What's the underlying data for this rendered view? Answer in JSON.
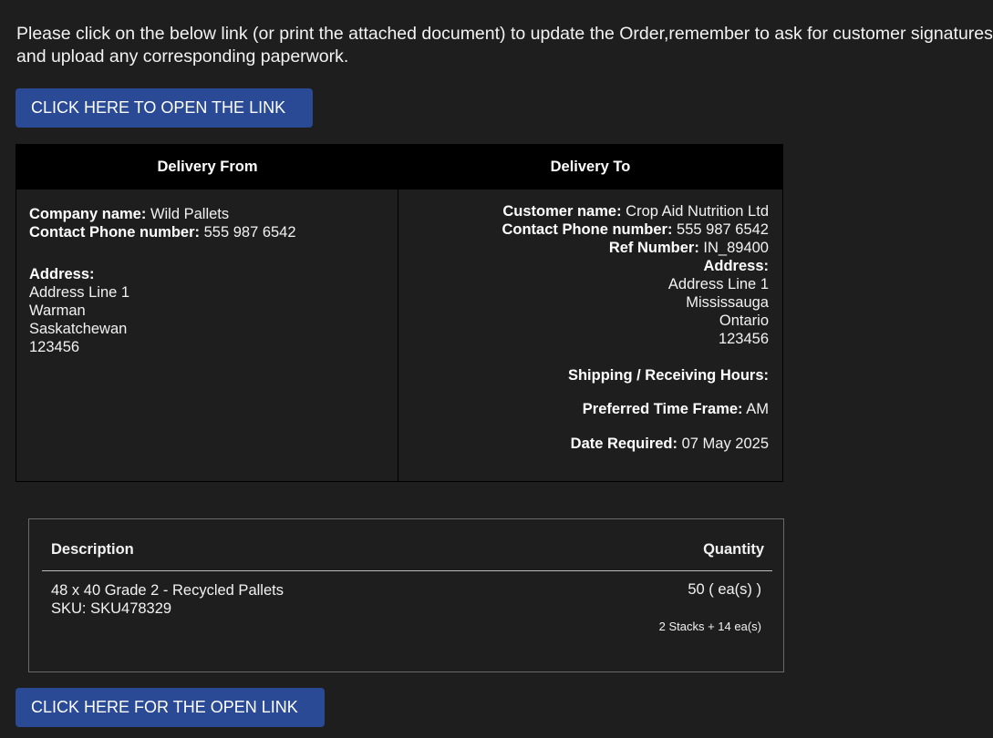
{
  "intro_text": "Please click on the below link (or print the attached document) to update the Order,remember to ask for customer signatures and upload any corresponding paperwork.",
  "buttons": {
    "top_label": "CLICK HERE TO OPEN THE LINK",
    "bottom_label": "CLICK HERE FOR THE OPEN LINK",
    "color": "#2a4a96"
  },
  "delivery": {
    "from_header": "Delivery From",
    "to_header": "Delivery To",
    "from": {
      "company_label": "Company name:",
      "company_value": " Wild Pallets",
      "phone_label": "Contact Phone number:",
      "phone_value": " 555 987 6542",
      "address_label": "Address:",
      "address_lines": [
        "Address Line 1",
        "Warman",
        "Saskatchewan",
        "123456"
      ]
    },
    "to": {
      "customer_label": "Customer name:",
      "customer_value": " Crop Aid Nutrition Ltd",
      "phone_label": "Contact Phone number:",
      "phone_value": " 555 987 6542",
      "ref_label": "Ref Number:",
      "ref_value": " IN_89400",
      "address_label": "Address:",
      "address_lines": [
        "Address Line 1",
        "Mississauga",
        "Ontario",
        "123456"
      ],
      "hours_label": "Shipping / Receiving Hours:",
      "timeframe_label": "Preferred Time Frame:",
      "timeframe_value": " AM",
      "date_label": "Date Required:",
      "date_value": " 07 May 2025"
    }
  },
  "items": {
    "description_header": "Description",
    "quantity_header": "Quantity",
    "rows": [
      {
        "name": "48 x 40 Grade 2 - Recycled Pallets",
        "sku": "SKU: SKU478329",
        "quantity": "50 ( ea(s) )",
        "stacks": "2 Stacks + 14 ea(s)"
      }
    ]
  }
}
